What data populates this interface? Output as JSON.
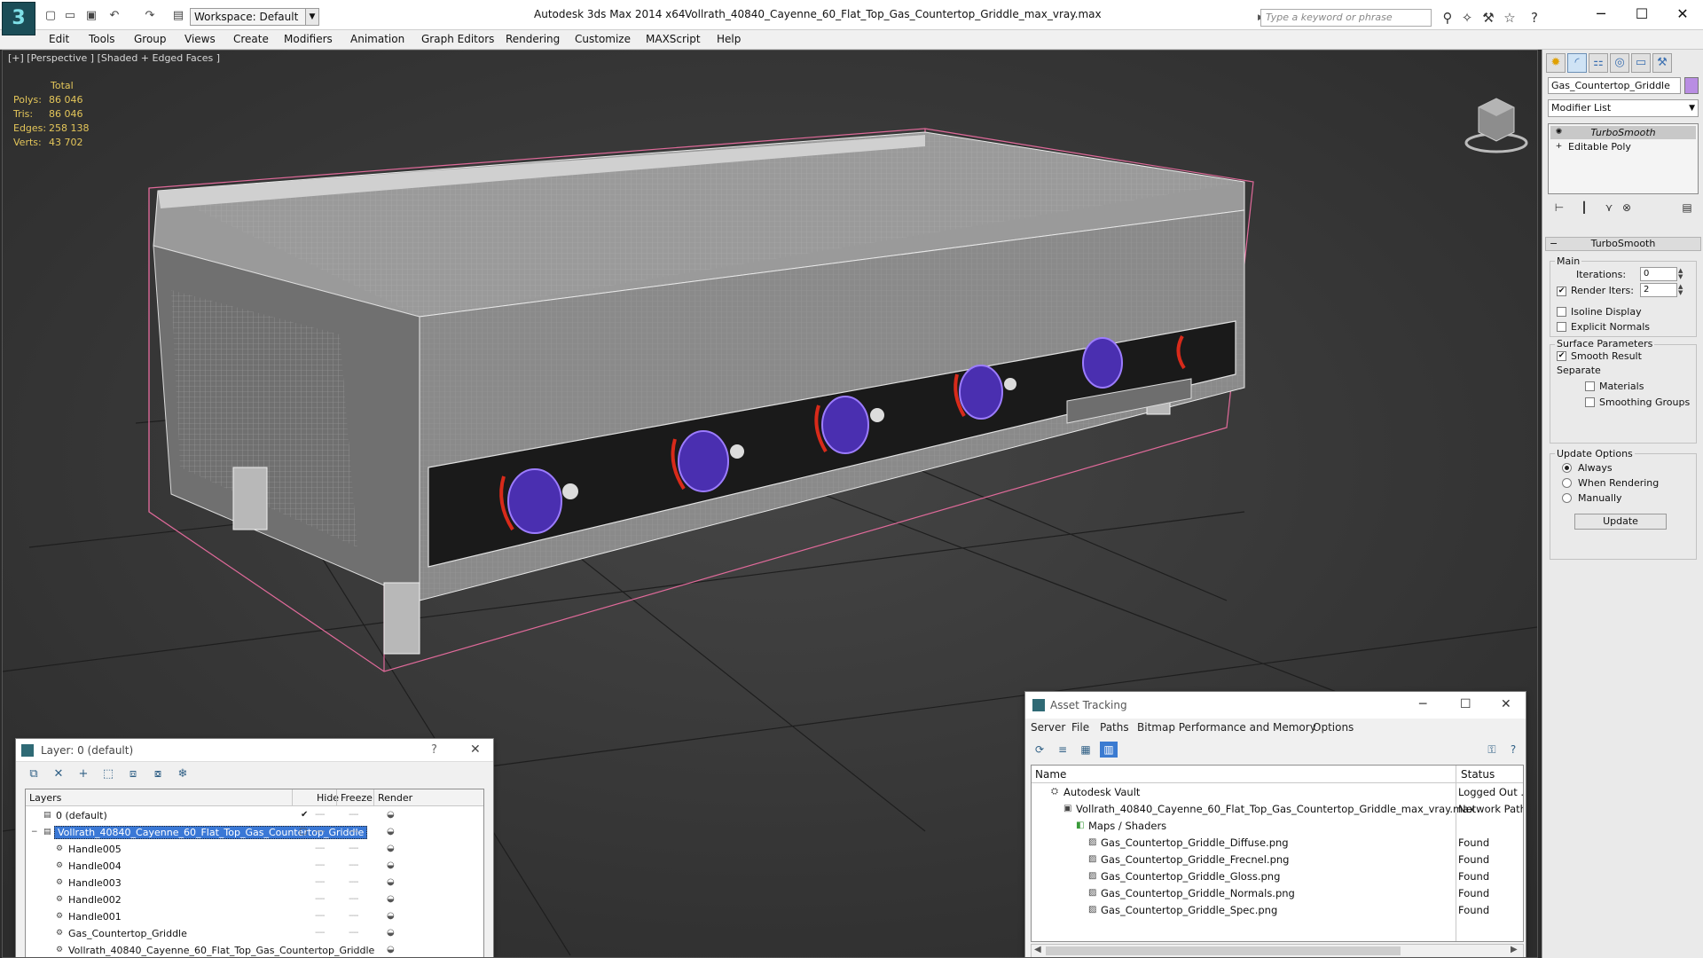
{
  "titlebar": {
    "workspace": "Workspace: Default",
    "app_title": "Autodesk 3ds Max  2014 x64",
    "document_title": "Vollrath_40840_Cayenne_60_Flat_Top_Gas_Countertop_Griddle_max_vray.max",
    "search_placeholder": "Type a keyword or phrase",
    "logo_glyph": "3"
  },
  "menu": [
    "Edit",
    "Tools",
    "Group",
    "Views",
    "Create",
    "Modifiers",
    "Animation",
    "Graph Editors",
    "Rendering",
    "Customize",
    "MAXScript",
    "Help"
  ],
  "viewport": {
    "label": "[+] [Perspective ] [Shaded + Edged Faces ]",
    "stats": {
      "header": "Total",
      "rows": [
        {
          "key": "Polys:",
          "value": "86 046"
        },
        {
          "key": "Tris:",
          "value": "86 046"
        },
        {
          "key": "Edges:",
          "value": "258 138"
        },
        {
          "key": "Verts:",
          "value": "43 702"
        }
      ]
    }
  },
  "command_panel": {
    "object_name": "Gas_Countertop_Griddle",
    "object_color": "#b98de3",
    "modifier_list": "Modifier List",
    "stack": [
      "TurboSmooth",
      "Editable Poly"
    ],
    "rollout_title": "TurboSmooth",
    "main_group": "Main",
    "iterations_label": "Iterations:",
    "iterations_value": "0",
    "render_iters_label": "Render Iters:",
    "render_iters_value": "2",
    "isoline_display": "Isoline Display",
    "explicit_normals": "Explicit Normals",
    "surface_group": "Surface Parameters",
    "smooth_result": "Smooth Result",
    "separate_label": "Separate",
    "materials": "Materials",
    "smoothing_groups": "Smoothing Groups",
    "update_group": "Update Options",
    "always": "Always",
    "when_rendering": "When Rendering",
    "manually": "Manually",
    "update_button": "Update"
  },
  "layer_window": {
    "title": "Layer: 0 (default)",
    "help": "?",
    "columns": [
      "Layers",
      "Hide",
      "Freeze",
      "Render"
    ],
    "rows": [
      {
        "name": "0 (default)",
        "indent": 0
      },
      {
        "name": "Vollrath_40840_Cayenne_60_Flat_Top_Gas_Countertop_Griddle",
        "indent": 0
      },
      {
        "name": "Handle005",
        "indent": 1
      },
      {
        "name": "Handle004",
        "indent": 1
      },
      {
        "name": "Handle003",
        "indent": 1
      },
      {
        "name": "Handle002",
        "indent": 1
      },
      {
        "name": "Handle001",
        "indent": 1
      },
      {
        "name": "Gas_Countertop_Griddle",
        "indent": 1
      },
      {
        "name": "Vollrath_40840_Cayenne_60_Flat_Top_Gas_Countertop_Griddle",
        "indent": 1
      }
    ]
  },
  "asset_window": {
    "title": "Asset Tracking",
    "menu": [
      "Server",
      "File",
      "Paths",
      "Bitmap Performance and Memory",
      "Options"
    ],
    "columns": [
      "Name",
      "Status"
    ],
    "rows": [
      {
        "name": "Autodesk Vault",
        "status": "Logged Out ..."
      },
      {
        "name": "Vollrath_40840_Cayenne_60_Flat_Top_Gas_Countertop_Griddle_max_vray.max",
        "status": "Network Path"
      },
      {
        "name": "Maps / Shaders",
        "status": ""
      },
      {
        "name": "Gas_Countertop_Griddle_Diffuse.png",
        "status": "Found"
      },
      {
        "name": "Gas_Countertop_Griddle_Frecnel.png",
        "status": "Found"
      },
      {
        "name": "Gas_Countertop_Griddle_Gloss.png",
        "status": "Found"
      },
      {
        "name": "Gas_Countertop_Griddle_Normals.png",
        "status": "Found"
      },
      {
        "name": "Gas_Countertop_Griddle_Spec.png",
        "status": "Found"
      }
    ]
  }
}
